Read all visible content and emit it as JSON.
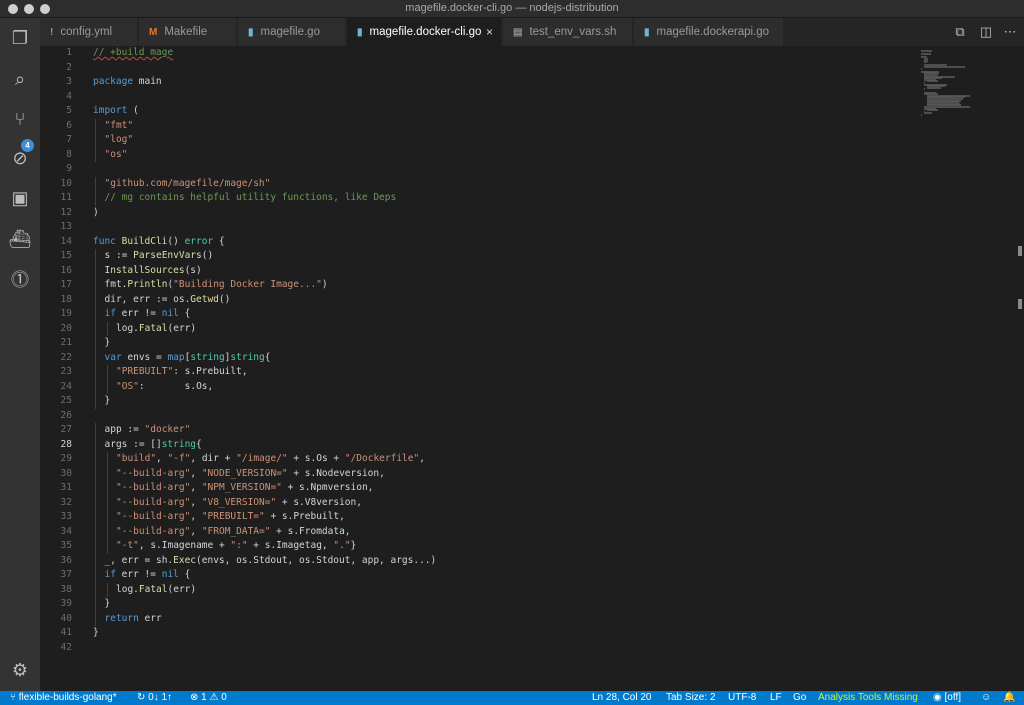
{
  "window": {
    "title": "magefile.docker-cli.go — nodejs-distribution"
  },
  "activity_bar": {
    "items": [
      {
        "name": "explorer-icon",
        "glyph": "❐"
      },
      {
        "name": "search-icon",
        "glyph": "⌕"
      },
      {
        "name": "source-control-icon",
        "glyph": "⑂"
      },
      {
        "name": "debug-icon",
        "glyph": "⊘"
      },
      {
        "name": "extensions-icon",
        "glyph": "▣"
      },
      {
        "name": "docker-icon",
        "glyph": "⛴"
      },
      {
        "name": "gitlens-icon",
        "glyph": "⓵"
      }
    ],
    "scm_badge": "4",
    "settings_glyph": "⚙"
  },
  "tabs": [
    {
      "label": "config.yml",
      "icon": "!",
      "icon_color": "#cc6bd6"
    },
    {
      "label": "Makefile",
      "icon": "M",
      "icon_color": "#e37933"
    },
    {
      "label": "magefile.go",
      "icon": "▮",
      "icon_color": "#6fb3d6"
    },
    {
      "label": "magefile.docker-cli.go",
      "icon": "▮",
      "icon_color": "#6fb3d6",
      "active": true
    },
    {
      "label": "test_env_vars.sh",
      "icon": "▤",
      "icon_color": "#8f8f8f"
    },
    {
      "label": "magefile.dockerapi.go",
      "icon": "▮",
      "icon_color": "#6fb3d6"
    }
  ],
  "tab_close_glyph": "×",
  "editor": {
    "current_line": 28,
    "lines": [
      "// +build mage",
      "",
      "package main",
      "",
      "import (",
      "\t\"fmt\"",
      "\t\"log\"",
      "\t\"os\"",
      "",
      "\t\"github.com/magefile/mage/sh\"",
      "\t// mg contains helpful utility functions, like Deps",
      ")",
      "",
      "func BuildCli() error {",
      "\ts := ParseEnvVars()",
      "\tInstallSources(s)",
      "\tfmt.Println(\"Building Docker Image...\")",
      "\tdir, err := os.Getwd()",
      "\tif err != nil {",
      "\t\tlog.Fatal(err)",
      "\t}",
      "\tvar envs = map[string]string{",
      "\t\t\"PREBUILT\": s.Prebuilt,",
      "\t\t\"OS\":       s.Os,",
      "\t}",
      "",
      "\tapp := \"docker\"",
      "\targs := []string{",
      "\t\t\"build\", \"-f\", dir + \"/image/\" + s.Os + \"/Dockerfile\",",
      "\t\t\"--build-arg\", \"NODE_VERSION=\" + s.Nodeversion,",
      "\t\t\"--build-arg\", \"NPM_VERSION=\" + s.Npmversion,",
      "\t\t\"--build-arg\", \"V8_VERSION=\" + s.V8version,",
      "\t\t\"--build-arg\", \"PREBUILT=\" + s.Prebuilt,",
      "\t\t\"--build-arg\", \"FROM_DATA=\" + s.Fromdata,",
      "\t\t\"-t\", s.Imagename + \":\" + s.Imagetag, \".\"}",
      "\t_, err = sh.Exec(envs, os.Stdout, os.Stdout, app, args...)",
      "\tif err != nil {",
      "\t\tlog.Fatal(err)",
      "\t}",
      "\treturn err",
      "}",
      ""
    ]
  },
  "colors": {
    "keyword": "#569cd6",
    "string": "#ce9178",
    "comment": "#6a9955",
    "function": "#dcdcaa",
    "type": "#4ec9b0",
    "variable": "#9cdcfe",
    "statusbar": "#007acc"
  },
  "status_bar": {
    "branch": "⑂ flexible-builds-golang*",
    "sync": "↻ 0↓ 1↑",
    "problems": "⊗ 1 ⚠ 0",
    "cursor": "Ln 28, Col 20",
    "tab_size": "Tab Size: 2",
    "encoding": "UTF-8",
    "eol": "LF",
    "language": "Go",
    "analysis": "Analysis Tools Missing",
    "live": "◉ [off]",
    "feedback_glyph": "☺",
    "bell_glyph": "🔔"
  }
}
